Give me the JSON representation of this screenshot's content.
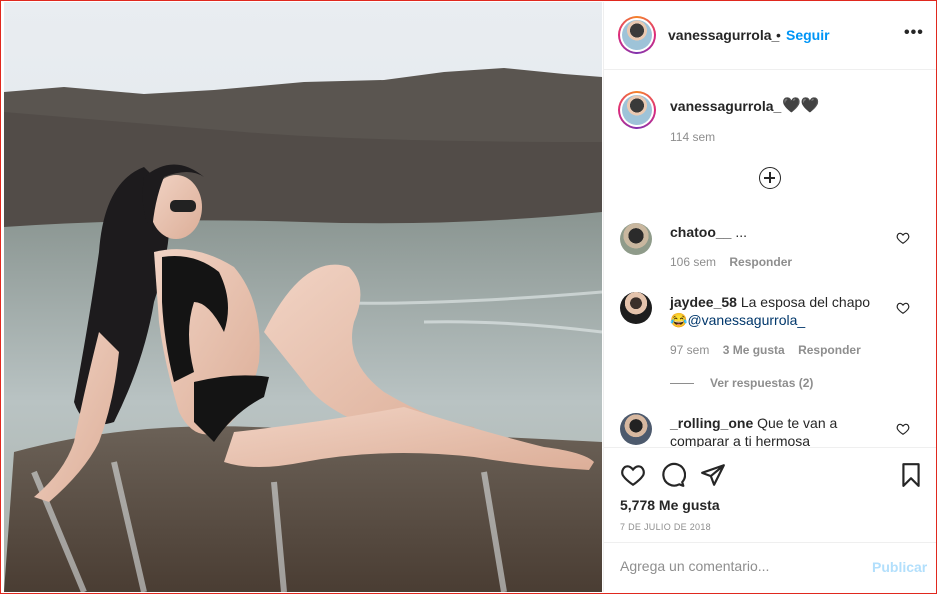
{
  "post": {
    "username": "vanessagurrola_",
    "dot": "•",
    "follow_label": "Seguir",
    "more_label": "•••",
    "caption_hearts": "🖤🖤",
    "caption_age": "114 sem",
    "likes": "5,778 Me gusta",
    "date": "7 DE JULIO DE 2018",
    "add_comment_placeholder": "Agrega un comentario...",
    "publish_label": "Publicar"
  },
  "comments": [
    {
      "username": "chatoo__",
      "text": "...",
      "age": "106 sem",
      "reply_label": "Responder"
    },
    {
      "username": "jaydee_58",
      "text": "La esposa del chapo",
      "emoji": "😂",
      "mention": "@vanessagurrola_",
      "age": "97 sem",
      "likes_label": "3 Me gusta",
      "reply_label": "Responder",
      "view_replies": "Ver respuestas (2)"
    },
    {
      "username": "_rolling_one",
      "text": "Que te van a comparar a ti hermosa"
    }
  ],
  "icons": {
    "like": "heart-icon",
    "comment": "comment-icon",
    "share": "send-icon",
    "save": "bookmark-icon",
    "new_comments": "plus-circle-icon",
    "options": "more-icon"
  },
  "colors": {
    "accent": "#0095f6",
    "publish_disabled": "#b2dffc",
    "muted": "#8e8e8e",
    "text": "#262626",
    "frame": "#e0281e"
  }
}
